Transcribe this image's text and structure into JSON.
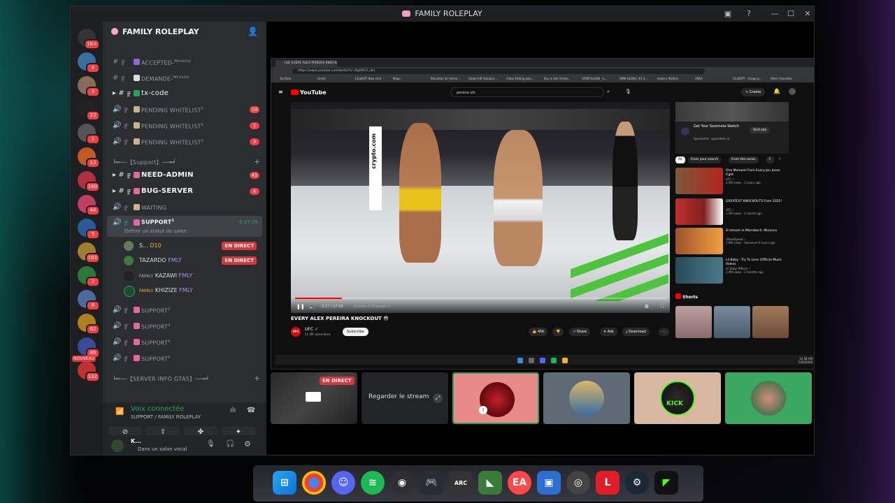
{
  "window": {
    "title": "FAMILY ROLEPLAY"
  },
  "server_list": [
    {
      "badge": "1K+"
    },
    {
      "badge": "8"
    },
    {
      "badge": "3"
    },
    {
      "badge": "23"
    },
    {
      "badge": "1"
    },
    {
      "badge": "13"
    },
    {
      "badge": "180"
    },
    {
      "badge": "44"
    },
    {
      "badge": "5"
    },
    {
      "badge": "103"
    },
    {
      "badge": "2"
    },
    {
      "badge": "8"
    },
    {
      "badge": "62"
    },
    {
      "badge": "46"
    },
    {
      "badge": "132",
      "label": "NOUVEAU"
    }
  ],
  "guild": {
    "name": "FAMILY ROLEPLAY"
  },
  "channels": [
    {
      "label": "ACCEPTED-",
      "sub": "Whitelist"
    },
    {
      "label": "DEMANDE-",
      "sub": "Whitelist"
    },
    {
      "label": "tx-code"
    },
    {
      "label": "PENDING WHITELIST",
      "sup": "1",
      "badge": "10"
    },
    {
      "label": "PENDING WHITELIST",
      "sup": "2",
      "badge": "1"
    },
    {
      "label": "PENDING WHITELIST",
      "sup": "3",
      "badge": "3"
    }
  ],
  "category_support": "╘═──【Support】──═╛",
  "support_channels": [
    {
      "label": "NEED-ADMIN",
      "badge": "45"
    },
    {
      "label": "BUG-SERVER",
      "badge": "4"
    },
    {
      "label": "WAITING"
    },
    {
      "label": "SUPPORT",
      "sup": "1",
      "time": "6:37:29",
      "status": "Définir un statut de salon"
    }
  ],
  "members": [
    {
      "name": "S...",
      "tag": "D10",
      "live": "EN DIRECT"
    },
    {
      "name": "TAZARDO",
      "tag": "FMLY",
      "live": "EN DIRECT"
    },
    {
      "name": "KAZAWI",
      "prefix": "FAMILY",
      "tag": "FMLY"
    },
    {
      "name": "KHIZIZE",
      "prefix": "FAMILY",
      "tag": "FMLY"
    }
  ],
  "support_more": [
    {
      "label": "SUPPORT",
      "sup": "2"
    },
    {
      "label": "SUPPORT",
      "sup": "3"
    },
    {
      "label": "SUPPORT",
      "sup": "4"
    },
    {
      "label": "SUPPORT",
      "sup": "5"
    }
  ],
  "category_server_info": "╘═──【SERVER INFO GTA5】──═╛",
  "voice": {
    "status": "Voix connectée",
    "location": "SUPPORT / FAMILY ROLEPLAY"
  },
  "user": {
    "name": "K...",
    "status": "Dans un salon vocal"
  },
  "browser": {
    "tab_title": "(18) EVERY ALEX PEREIRA KNOCKOUT",
    "url": "https://www.youtube.com/watch?v=Rgh0CH_ckU",
    "bookmarks": [
      "YouTube",
      "Gmail",
      "ChatGPT New chat",
      "Maps",
      "Résultats de recher...",
      "Global HR Solution...",
      "Video Editing Jobs...",
      "Buy & Sell Online...",
      "VITBFOLLOW - L...",
      "SMM GLOW | #1 S...",
      "Home | Politico",
      "XREA",
      "ChatGPT - Image g...",
      "Other Favorites"
    ]
  },
  "youtube": {
    "logo": "YouTube",
    "search": "pereira ufc",
    "create": "+ Create",
    "video_title": "EVERY ALEX PEREIRA KNOCKOUT 😳",
    "time": "2:17 / 17:58",
    "chapter": "Pereira vs Brandell >",
    "channel": "UFC ✓",
    "subs": "21.4M subscribers",
    "subscribe": "Subscribe",
    "likes": "👍 45K",
    "share": "Share",
    "ask": "Ask",
    "download": "Download",
    "ad_title": "Get Your Soulmate Sketch",
    "ad_sponsor": "Sponsored · appreitale.co",
    "ad_visit": "Visit site",
    "chips": [
      "All",
      "From your search",
      "From the series",
      "F"
    ],
    "recs": [
      {
        "title": "One Moment From Every Jon Jones Fight",
        "meta": "UFC ✓\n2.5M views · 2 years ago"
      },
      {
        "title": "GREATEST KNOCKOUTS From 2025!",
        "meta": "UFC ✓\n1.5M views · 1 month ago"
      },
      {
        "title": "ill stream in Marrakech, Morocco",
        "meta": "iShowSpeed ✓\n2.9M views · Streamed 9 hours ago"
      },
      {
        "title": "Lil Baby - Try To Love (Official Music Video)",
        "meta": "Lil Baby Official ✓\n2.9M views · 2 months ago"
      }
    ],
    "shorts": "Shorts",
    "clock": "12:58 AM\n1/20/2026"
  },
  "stream_tiles": {
    "live": "EN DIRECT",
    "watch": "Regarder le stream",
    "kick": "KICK"
  },
  "colors": {
    "accent": "#5865f2",
    "live": "#da373c",
    "online": "#23a55a",
    "youtube_red": "#ff0000"
  }
}
